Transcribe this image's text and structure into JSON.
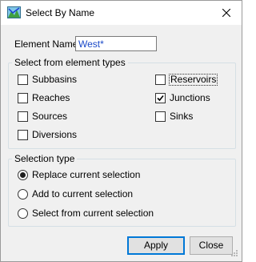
{
  "window": {
    "title": "Select By Name"
  },
  "element_name": {
    "label": "Element Name:",
    "value": "West*"
  },
  "element_types": {
    "legend": "Select from element types",
    "items": [
      {
        "label": "Subbasins",
        "checked": false
      },
      {
        "label": "Reaches",
        "checked": false
      },
      {
        "label": "Sources",
        "checked": false
      },
      {
        "label": "Diversions",
        "checked": false
      },
      {
        "label": "Reservoirs",
        "checked": false
      },
      {
        "label": "Junctions",
        "checked": true
      },
      {
        "label": "Sinks",
        "checked": false
      }
    ]
  },
  "selection_type": {
    "legend": "Selection type",
    "options": [
      {
        "label": "Replace current selection",
        "selected": true
      },
      {
        "label": "Add to current selection",
        "selected": false
      },
      {
        "label": "Select from current selection",
        "selected": false
      }
    ]
  },
  "buttons": {
    "apply": "Apply",
    "close": "Close"
  },
  "colors": {
    "accent": "#0078d7",
    "input_text": "#1a49c8"
  },
  "icons": [
    "app-icon",
    "close-icon",
    "checkmark-icon",
    "resize-grip-icon"
  ]
}
